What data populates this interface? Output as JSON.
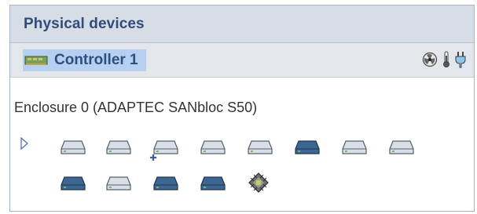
{
  "panel": {
    "title": "Physical devices"
  },
  "controller": {
    "label": "Controller 1",
    "icons": [
      "controller-board-icon"
    ],
    "status_icons": [
      "fan-icon",
      "temperature-icon",
      "power-icon"
    ]
  },
  "enclosure": {
    "label": "Enclosure 0 (ADAPTEC SANbloc S50)",
    "devices_row_1": [
      {
        "kind": "drive",
        "state": "normal"
      },
      {
        "kind": "drive",
        "state": "normal"
      },
      {
        "kind": "drive",
        "state": "hot-spare"
      },
      {
        "kind": "drive",
        "state": "normal"
      },
      {
        "kind": "drive",
        "state": "normal"
      },
      {
        "kind": "drive",
        "state": "assigned"
      },
      {
        "kind": "drive",
        "state": "normal"
      },
      {
        "kind": "drive",
        "state": "normal"
      }
    ],
    "devices_row_2": [
      {
        "kind": "drive",
        "state": "assigned"
      },
      {
        "kind": "drive",
        "state": "normal"
      },
      {
        "kind": "drive",
        "state": "assigned"
      },
      {
        "kind": "drive",
        "state": "assigned"
      },
      {
        "kind": "chip",
        "state": "enclosure-manager"
      }
    ]
  },
  "colors": {
    "header_bg": "#d7dde5",
    "title": "#314c7a",
    "selection": "#b7cff0",
    "drive_normal": "#d9dfe6",
    "drive_assigned": "#3d6791"
  }
}
